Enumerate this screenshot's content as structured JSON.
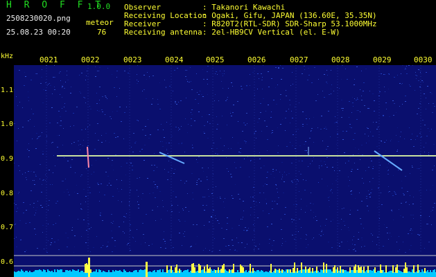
{
  "header": {
    "app_title": "H R O F F T",
    "version": "1.0.0",
    "filename": "2508230020.png",
    "datetime": "25.08.23 00:20",
    "meteor_label": "meteor",
    "meteor_count": "76"
  },
  "info": [
    {
      "key": "Observer",
      "value": ": Takanori Kawachi"
    },
    {
      "key": "Receiving Location",
      "value": ": Ogaki, Gifu, JAPAN (136.60E, 35.35N)"
    },
    {
      "key": "Receiver",
      "value": ": R820T2(RTL-SDR) SDR-Sharp 53.1000MHz"
    },
    {
      "key": "Receiving antenna",
      "value": ": 2el-HB9CV Vertical (el. E-W)"
    }
  ],
  "chart_data": {
    "type": "heatmap",
    "y_unit": "kHz",
    "y_ticks": [
      "1.1",
      "1.0",
      "0.9",
      "0.8",
      "0.7",
      "0.6"
    ],
    "x_ticks": [
      "0021",
      "0022",
      "0023",
      "0024",
      "0025",
      "0026",
      "0027",
      "0028",
      "0029",
      "0030"
    ],
    "carrier_khz": 0.91,
    "colors": {
      "background": "#0a0f6e",
      "carrier": "#c8e0a0",
      "meteor": "#66aaff",
      "spike": "#ff88aa",
      "level_fill": "#00c8ff",
      "level_peaks": "#ffff44",
      "axis_text": "#ffff33"
    }
  }
}
